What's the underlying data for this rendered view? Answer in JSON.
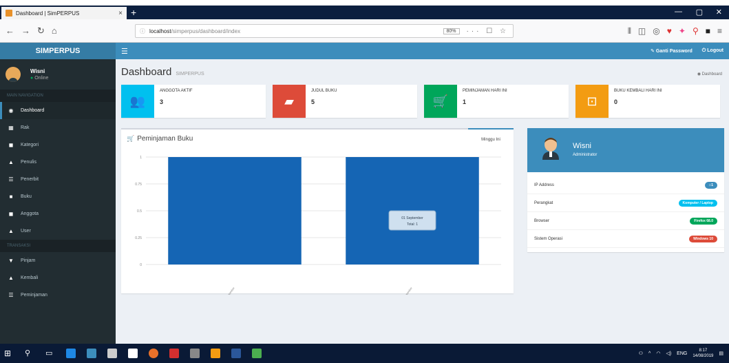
{
  "browser": {
    "tab_title": "Dashboard | SimPERPUS",
    "tab_close": "×",
    "new_tab": "+",
    "url_host": "localhost",
    "url_path": "/simperpus/dashboard/index",
    "zoom": "80%",
    "url_actions": "··· ☐ ☆"
  },
  "app": {
    "logo": "SIMPERPUS",
    "change_password": "Ganti Password",
    "logout": "Logout"
  },
  "sidebar": {
    "user_name": "Wisni",
    "user_status": "Online",
    "header_main": "MAIN NAVIGATION",
    "header_transaksi": "TRANSAKSI",
    "items": [
      {
        "label": "Dashboard",
        "icon": "dashboard-icon",
        "glyph": "◉",
        "active": true
      },
      {
        "label": "Rak",
        "icon": "grid-icon",
        "glyph": "▦",
        "active": false
      },
      {
        "label": "Kategori",
        "icon": "bookmark-icon",
        "glyph": "◼",
        "active": false
      },
      {
        "label": "Penulis",
        "icon": "user-icon",
        "glyph": "▲",
        "active": false
      },
      {
        "label": "Penerbit",
        "icon": "list-icon",
        "glyph": "☰",
        "active": false
      },
      {
        "label": "Buku",
        "icon": "book-icon",
        "glyph": "■",
        "active": false
      },
      {
        "label": "Anggota",
        "icon": "users-icon",
        "glyph": "◼",
        "active": false
      },
      {
        "label": "User",
        "icon": "person-icon",
        "glyph": "▲",
        "active": false
      },
      {
        "label": "Pinjam",
        "icon": "cart-icon",
        "glyph": "▼",
        "active": false
      },
      {
        "label": "Kembali",
        "icon": "return-icon",
        "glyph": "▲",
        "active": false
      },
      {
        "label": "Peminjaman",
        "icon": "list-icon",
        "glyph": "☰",
        "active": false
      }
    ]
  },
  "content": {
    "title": "Dashboard",
    "subtitle": "SIMPERPUS",
    "breadcrumb": "Dashboard"
  },
  "info_boxes": [
    {
      "label": "ANGGOTA AKTIF",
      "value": "3",
      "color": "#00c0ef",
      "icon": "users-icon",
      "glyph": "👥"
    },
    {
      "label": "JUDUL BUKU",
      "value": "5",
      "color": "#dd4b39",
      "icon": "book-icon",
      "glyph": "▰"
    },
    {
      "label": "PEMINJAMAN HARI INI",
      "value": "1",
      "color": "#00a65a",
      "icon": "cart-icon",
      "glyph": "🛒"
    },
    {
      "label": "BUKU KEMBALI HARI INI",
      "value": "0",
      "color": "#f39c12",
      "icon": "inbox-icon",
      "glyph": "⊡"
    }
  ],
  "chart_box": {
    "title": "Peminjaman Buku",
    "tab": "Minggu Ini",
    "tooltip_line1": "01 September",
    "tooltip_line2": "Total: 1"
  },
  "chart_data": {
    "type": "bar",
    "categories": [
      "01 September",
      "02 September"
    ],
    "values": [
      1,
      1
    ],
    "title": "Peminjaman Buku",
    "xlabel": "",
    "ylabel": "",
    "ylim": [
      0,
      1
    ],
    "yticks": [
      "1",
      "0.75",
      "0.5",
      "0.25",
      "0"
    ],
    "color": "#1565b4",
    "grid": true
  },
  "profile": {
    "name": "Wisni",
    "role": "Administrator",
    "rows": [
      {
        "label": "IP Address",
        "value": "::1",
        "color": "#3c8dbc"
      },
      {
        "label": "Perangkat",
        "value": "Komputer / Laptop",
        "color": "#00c0ef"
      },
      {
        "label": "Browser",
        "value": "Firefox 68.0",
        "color": "#00a65a"
      },
      {
        "label": "Sistem Operasi",
        "value": "Windows 10",
        "color": "#dd4b39"
      }
    ]
  },
  "taskbar": {
    "time": "8:17",
    "date": "14/08/2019",
    "lang": "ENG"
  }
}
